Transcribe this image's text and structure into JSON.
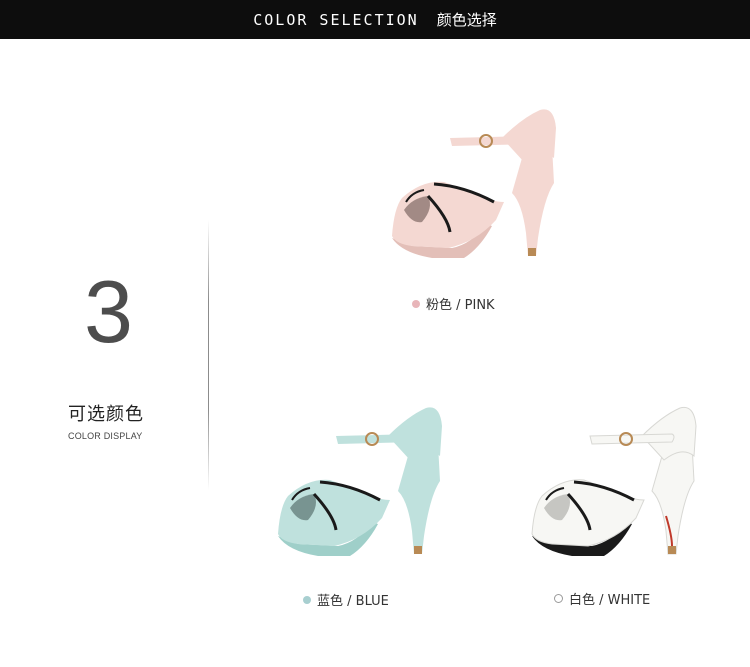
{
  "header": {
    "title_en": "COLOR SELECTION",
    "title_zh": "颜色选择"
  },
  "section": {
    "number": "3",
    "title_zh": "可选颜色",
    "title_en": "COLOR DISPLAY"
  },
  "colors": [
    {
      "label": "粉色 / PINK",
      "swatch": "#e8b5b9",
      "shoe": "#f4d8d2",
      "shoe_shade": "#e3bfb8"
    },
    {
      "label": "蓝色 / BLUE",
      "swatch": "#a8cfd0",
      "shoe": "#bfe1dd",
      "shoe_shade": "#9fcfc9"
    },
    {
      "label": "白色 / WHITE",
      "swatch": "#ffffff",
      "shoe": "#f7f7f4",
      "shoe_shade": "#e2e2de"
    }
  ]
}
